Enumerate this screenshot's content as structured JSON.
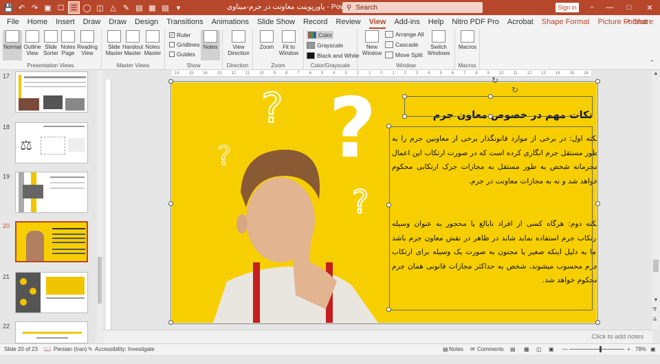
{
  "titlebar": {
    "doc_title": "پاورپوینت معاونت در جرم-میناوی - PowerPoint",
    "search_placeholder": "Search",
    "signin": "Sign in",
    "brand_color": "#b7472a"
  },
  "tabs": [
    {
      "label": "File"
    },
    {
      "label": "Home"
    },
    {
      "label": "Insert"
    },
    {
      "label": "Draw"
    },
    {
      "label": "Draw"
    },
    {
      "label": "Design"
    },
    {
      "label": "Transitions"
    },
    {
      "label": "Animations"
    },
    {
      "label": "Slide Show"
    },
    {
      "label": "Record"
    },
    {
      "label": "Review"
    },
    {
      "label": "View"
    },
    {
      "label": "Add-ins"
    },
    {
      "label": "Help"
    },
    {
      "label": "Nitro PDF Pro"
    },
    {
      "label": "Acrobat"
    },
    {
      "label": "Shape Format"
    },
    {
      "label": "Picture Format"
    }
  ],
  "share_label": "Share",
  "ribbon": {
    "presentation_views": {
      "label": "Presentation Views",
      "normal": "Normal",
      "outline": "Outline View",
      "sorter": "Slide Sorter",
      "notes_page": "Notes Page",
      "reading": "Reading View"
    },
    "master_views": {
      "label": "Master Views",
      "slide_master": "Slide Master",
      "handout_master": "Handout Master",
      "notes_master": "Notes Master"
    },
    "show": {
      "label": "Show",
      "ruler": "Ruler",
      "gridlines": "Gridlines",
      "guides": "Guides",
      "notes": "Notes"
    },
    "direction": {
      "label": "Direction",
      "view_direction": "View Direction"
    },
    "zoom": {
      "label": "Zoom",
      "zoom": "Zoom",
      "fit": "Fit to Window"
    },
    "color": {
      "label": "Color/Grayscale",
      "color": "Color",
      "grayscale": "Grayscale",
      "bw": "Black and White"
    },
    "window": {
      "label": "Window",
      "new_window": "New Window",
      "arrange_all": "Arrange All",
      "cascade": "Cascade",
      "move_split": "Move Split",
      "switch": "Switch Windows"
    },
    "macros": {
      "label": "Macros",
      "macros": "Macros"
    }
  },
  "thumbnails": [
    {
      "num": "17",
      "active": false
    },
    {
      "num": "18",
      "active": false
    },
    {
      "num": "19",
      "active": false
    },
    {
      "num": "20",
      "active": true
    },
    {
      "num": "21",
      "active": false
    },
    {
      "num": "22",
      "active": false
    }
  ],
  "slide": {
    "title": "نکات مهم در خصوص معاون جرم",
    "para1": "نکته اول: در برخی از موارد قانونگذار برخی از معاونین جرم را به طور مستقل جرم انگاری کرده است که در صورت ارتکاب این اعمال مجرمانه شخص به طور مستقل به مجازات جرک ارتکابی محکوم خواهد شد و نه به مجازات معاونت در جرم.",
    "para2": "نکته دوم: هرگاه کسی از افراد نابالغ یا محجور به عنوان وسیله ارتکاب جرم استفاده نماید شاید در ظاهر در نقش معاون جرم باشد اما به دلیل اینکه صغیر یا مجنون به صورت یک وسیله برای ارتکاب جرم محسوب میشوند، شخص به حداکثر مجازات قانونی همان جرم محکوم خواهد شد.",
    "bg_color": "#f7cf00"
  },
  "notes_placeholder": "Click to add notes",
  "status": {
    "slide": "Slide 20 of 23",
    "language": "Persian (Iran)",
    "accessibility": "Accessibility: Investigate",
    "notes": "Notes",
    "comments": "Comments",
    "zoom": "78%"
  }
}
